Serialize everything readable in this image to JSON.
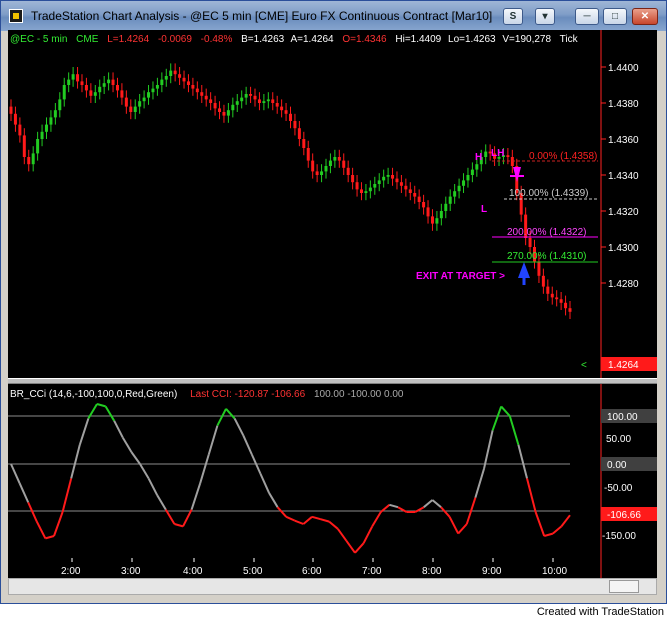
{
  "window": {
    "title": "TradeStation Chart Analysis - @EC 5 min [CME] Euro FX Continuous Contract [Mar10]",
    "footer": "Created with TradeStation"
  },
  "toolbar": {
    "s_label": "S",
    "dropdown_label": "▾"
  },
  "colors": {
    "up": "#22cc22",
    "down": "#ff1a1a",
    "accent": "#ff00ff",
    "cci_neutral": "#a0a0a0",
    "axis_text": "#ffffff"
  },
  "price_header": {
    "symbol": "@EC - 5 min",
    "exchange": "CME",
    "last": "L=1.4264",
    "change": "-0.0069",
    "pct": "-0.48%",
    "bid": "B=1.4263",
    "ask": "A=1.4264",
    "open": "O=1.4346",
    "high": "Hi=1.4409",
    "low": "Lo=1.4263",
    "volume": "V=190,278",
    "tick": "Tick"
  },
  "price_axis": {
    "labels": [
      "1.4400",
      "1.4380",
      "1.4360",
      "1.4340",
      "1.4320",
      "1.4300",
      "1.4280"
    ],
    "current": "1.4264",
    "marker": "<"
  },
  "cci_header": {
    "name": "BR_CCi (14,6,-100,100,0,Red,Green)",
    "last_label": "Last CCI: -120.87 -106.66",
    "levels": "100.00 -100.00 0.00"
  },
  "cci_axis": {
    "labels": [
      "50.00",
      "-50.00",
      "-150.00"
    ],
    "upper": "100.00",
    "zero": "0.00",
    "current": "-106.66"
  },
  "time_axis": {
    "labels": [
      "2:00",
      "3:00",
      "4:00",
      "5:00",
      "6:00",
      "7:00",
      "8:00",
      "9:00",
      "10:00"
    ]
  },
  "annotations": {
    "h": "H",
    "lh": "LH",
    "l": "L",
    "fib0": "0.00% (1.4358)",
    "fib100": "100.00% (1.4339)",
    "fib200": "200.00% (1.4322)",
    "fib270": "270.00% (1.4310)",
    "exit": "EXIT AT TARGET >"
  },
  "chart_data": [
    {
      "type": "candlestick",
      "title": "@EC - 5 min",
      "series": [
        {
          "name": "@EC",
          "close": [
            1.4374,
            1.4368,
            1.4362,
            1.435,
            1.4346,
            1.4352,
            1.436,
            1.4364,
            1.4368,
            1.4372,
            1.4376,
            1.4382,
            1.439,
            1.4393,
            1.4396,
            1.4392,
            1.439,
            1.4387,
            1.4384,
            1.4386,
            1.4389,
            1.4391,
            1.4393,
            1.439,
            1.4387,
            1.4383,
            1.4378,
            1.4375,
            1.4378,
            1.4381,
            1.4383,
            1.4386,
            1.4388,
            1.439,
            1.4393,
            1.4395,
            1.4398,
            1.4396,
            1.4394,
            1.4392,
            1.439,
            1.4388,
            1.4386,
            1.4384,
            1.4382,
            1.438,
            1.4377,
            1.4375,
            1.4373,
            1.4376,
            1.4379,
            1.4381,
            1.4383,
            1.4385,
            1.4384,
            1.4382,
            1.438,
            1.4381,
            1.4382,
            1.438,
            1.4378,
            1.4376,
            1.4374,
            1.437,
            1.4366,
            1.436,
            1.4355,
            1.4348,
            1.4342,
            1.434,
            1.4342,
            1.4345,
            1.4348,
            1.435,
            1.4348,
            1.4344,
            1.434,
            1.4336,
            1.4332,
            1.433,
            1.4331,
            1.4333,
            1.4335,
            1.4337,
            1.4339,
            1.434,
            1.4338,
            1.4336,
            1.4334,
            1.4332,
            1.433,
            1.4328,
            1.4325,
            1.4322,
            1.4317,
            1.4313,
            1.4316,
            1.432,
            1.4324,
            1.4328,
            1.4331,
            1.4334,
            1.4337,
            1.434,
            1.4343,
            1.4346,
            1.435,
            1.4353,
            1.4352,
            1.4349,
            1.435,
            1.4351,
            1.435,
            1.4345,
            1.433,
            1.4318,
            1.4305,
            1.43,
            1.4292,
            1.4284,
            1.4278,
            1.4274,
            1.4272,
            1.4271,
            1.4269,
            1.4266,
            1.4264
          ],
          "high_max": 1.4409,
          "low_min": 1.4263
        }
      ]
    },
    {
      "type": "line",
      "title": "BR_CCi (14,6,-100,100,0,Red,Green)",
      "ylim": [
        -190,
        150
      ],
      "series": [
        {
          "name": "CCI",
          "values": [
            0,
            -40,
            -80,
            -120,
            -155,
            -150,
            -100,
            -30,
            40,
            95,
            125,
            120,
            90,
            55,
            25,
            0,
            -30,
            -65,
            -95,
            -125,
            -130,
            -95,
            -40,
            20,
            80,
            115,
            95,
            60,
            20,
            -20,
            -60,
            -90,
            -110,
            -118,
            -125,
            -110,
            -115,
            -120,
            -135,
            -160,
            -185,
            -165,
            -130,
            -100,
            -85,
            -90,
            -100,
            -100,
            -90,
            -75,
            -90,
            -110,
            -145,
            -125,
            -70,
            -10,
            70,
            120,
            100,
            40,
            -30,
            -100,
            -150,
            -145,
            -130,
            -106.66
          ]
        }
      ]
    }
  ]
}
